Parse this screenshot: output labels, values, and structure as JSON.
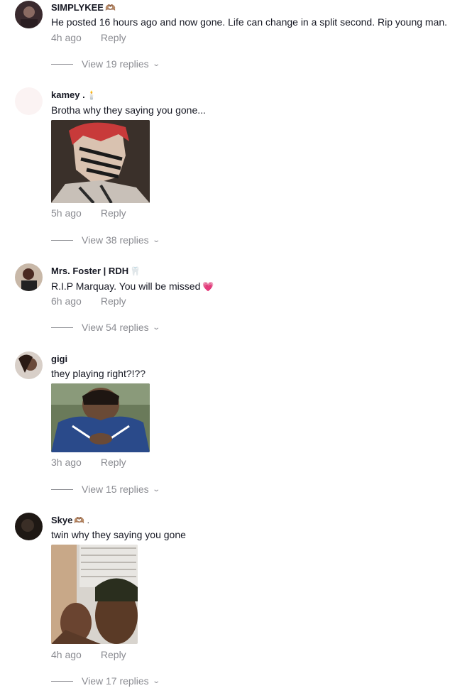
{
  "comments": [
    {
      "username": "SIMPLYKEE",
      "username_emoji": "🫶🏽",
      "text": "He posted 16 hours ago and now gone. Life can change in a split second. Rip young man.",
      "time": "4h ago",
      "reply_label": "Reply",
      "replies_label": "View 19 replies"
    },
    {
      "username": "kamey .",
      "username_emoji": "🕯️",
      "text": "Brotha why they saying you gone...",
      "time": "5h ago",
      "reply_label": "Reply",
      "replies_label": "View 38 replies"
    },
    {
      "username": "Mrs. Foster | RDH",
      "username_emoji": "🦷",
      "text": "R.I.P Marquay. You will be missed",
      "text_emoji": "💗",
      "time": "6h ago",
      "reply_label": "Reply",
      "replies_label": "View 54 replies"
    },
    {
      "username": "gigi",
      "text": "they playing right?!??",
      "time": "3h ago",
      "reply_label": "Reply",
      "replies_label": "View 15 replies"
    },
    {
      "username": "Skye",
      "username_emoji": "🫶🏽 .",
      "text": "twin why they saying you gone",
      "time": "4h ago",
      "reply_label": "Reply",
      "replies_label": "View 17 replies"
    }
  ],
  "icons": {
    "chevron": "chevron-down-icon"
  }
}
